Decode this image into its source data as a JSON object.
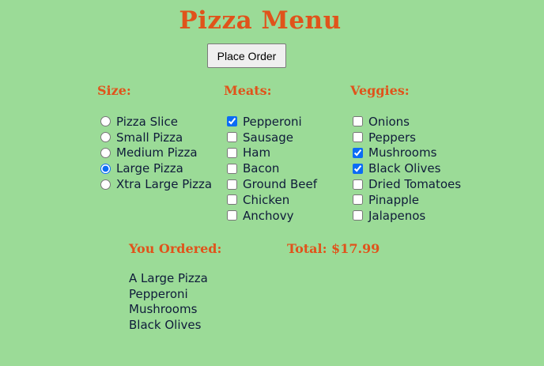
{
  "title": "Pizza Menu",
  "order_button": "Place Order",
  "size": {
    "heading": "Size:",
    "options": [
      {
        "label": "Pizza Slice",
        "selected": false
      },
      {
        "label": "Small Pizza",
        "selected": false
      },
      {
        "label": "Medium Pizza",
        "selected": false
      },
      {
        "label": "Large Pizza",
        "selected": true
      },
      {
        "label": "Xtra Large Pizza",
        "selected": false
      }
    ]
  },
  "meats": {
    "heading": "Meats:",
    "options": [
      {
        "label": "Pepperoni",
        "checked": true
      },
      {
        "label": "Sausage",
        "checked": false
      },
      {
        "label": "Ham",
        "checked": false
      },
      {
        "label": "Bacon",
        "checked": false
      },
      {
        "label": "Ground Beef",
        "checked": false
      },
      {
        "label": "Chicken",
        "checked": false
      },
      {
        "label": "Anchovy",
        "checked": false
      }
    ]
  },
  "veggies": {
    "heading": "Veggies:",
    "options": [
      {
        "label": "Onions",
        "checked": false
      },
      {
        "label": "Peppers",
        "checked": false
      },
      {
        "label": "Mushrooms",
        "checked": true
      },
      {
        "label": "Black Olives",
        "checked": true
      },
      {
        "label": "Dried Tomatoes",
        "checked": false
      },
      {
        "label": "Pinapple",
        "checked": false
      },
      {
        "label": "Jalapenos",
        "checked": false
      }
    ]
  },
  "ordered": {
    "heading": "You Ordered:",
    "lines": [
      "A Large Pizza",
      "Pepperoni",
      "Mushrooms",
      "Black Olives"
    ]
  },
  "total": {
    "label": "Total: $17.99"
  },
  "colors": {
    "background": "#9bdb97",
    "heading": "#e0531b",
    "text": "#0f1b3a"
  }
}
